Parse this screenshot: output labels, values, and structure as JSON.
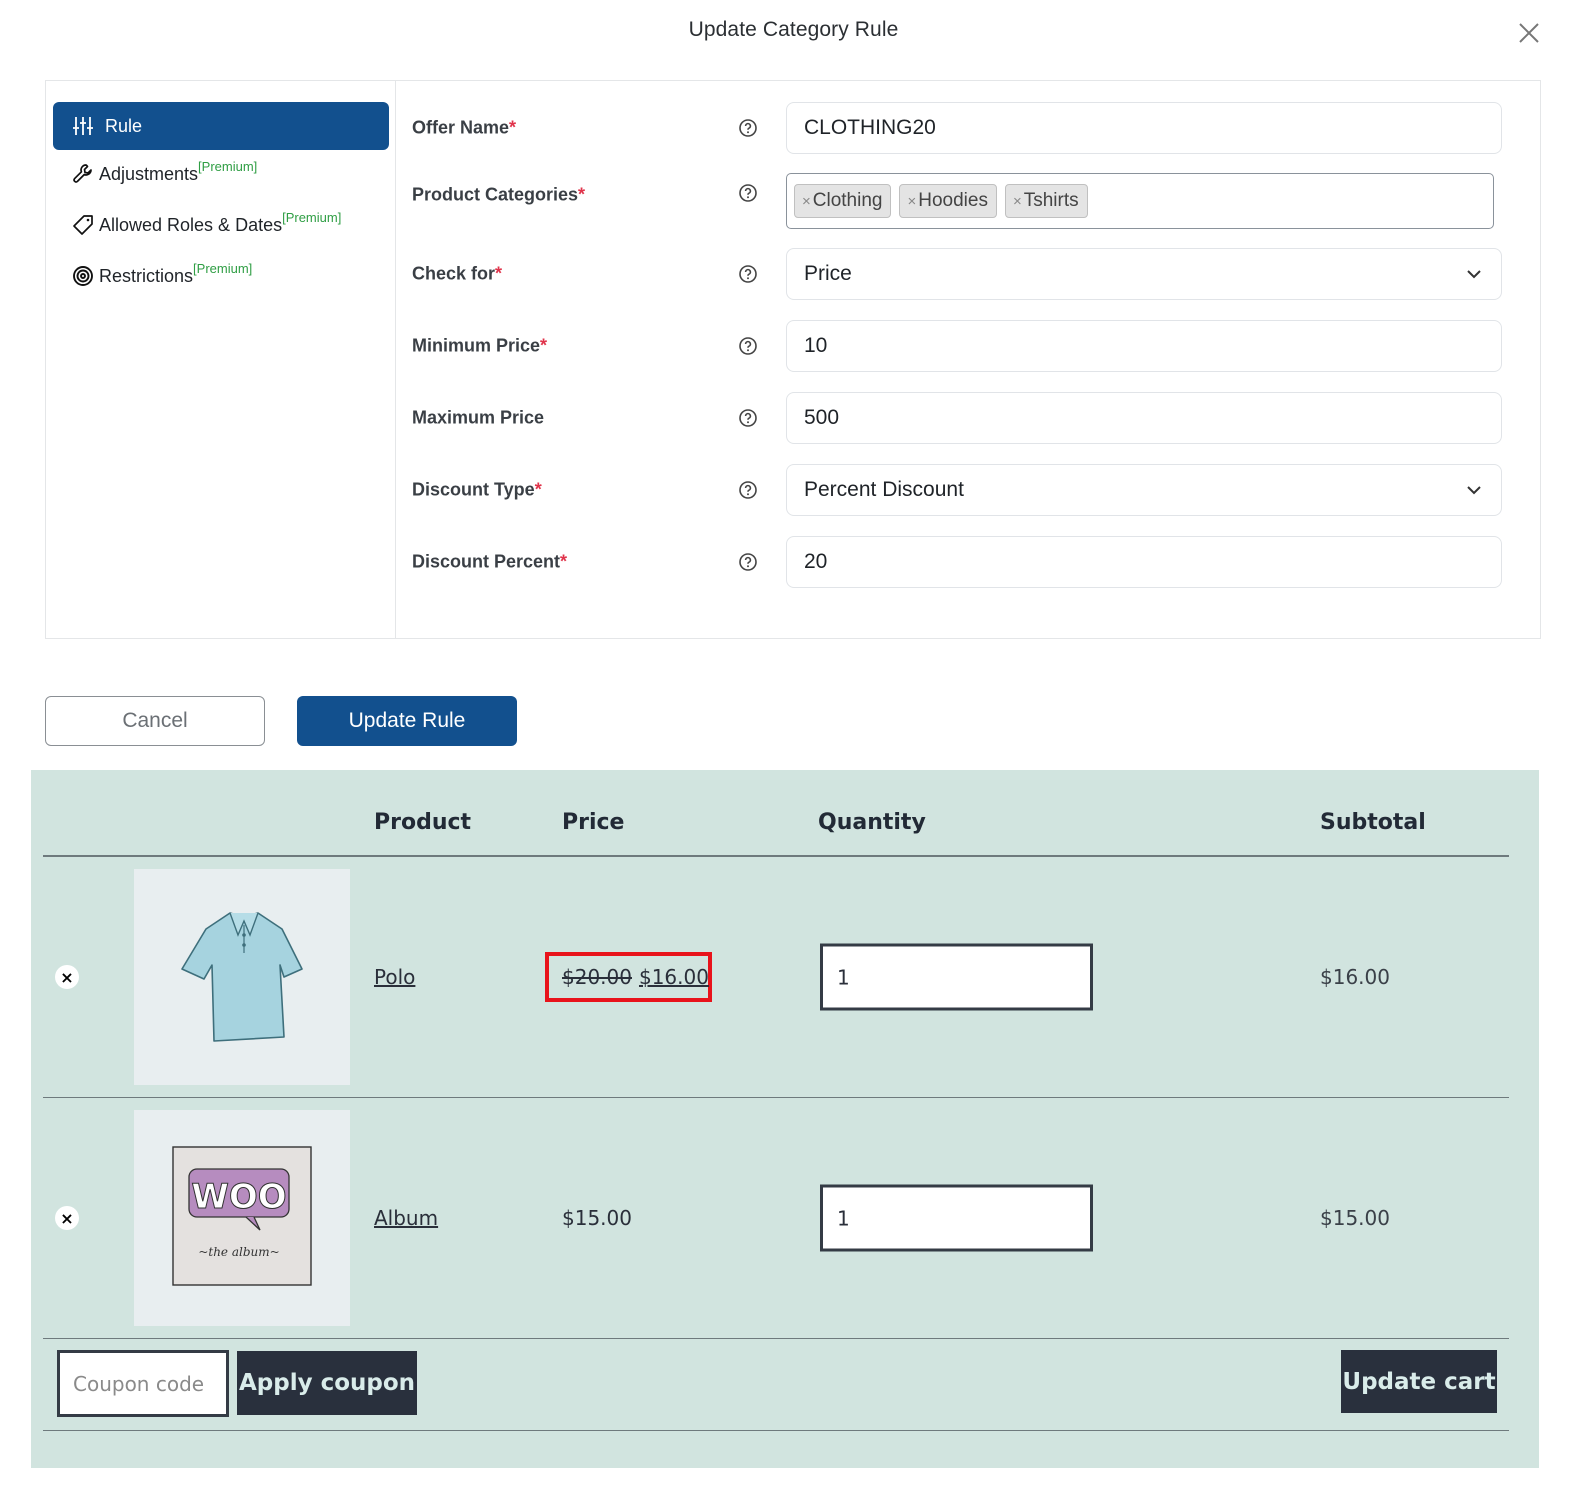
{
  "modal": {
    "title": "Update Category Rule",
    "close_icon": "close-icon"
  },
  "sidebar": {
    "items": [
      {
        "label": "Rule",
        "icon": "sliders-icon",
        "badge": "",
        "active": true
      },
      {
        "label": "Adjustments",
        "icon": "wrench-icon",
        "badge": "[Premium]",
        "active": false
      },
      {
        "label": "Allowed Roles & Dates",
        "icon": "tag-icon",
        "badge": "[Premium]",
        "active": false
      },
      {
        "label": "Restrictions",
        "icon": "target-icon",
        "badge": "[Premium]",
        "active": false
      }
    ]
  },
  "form": {
    "offer_name": {
      "label": "Offer Name",
      "required": "*",
      "value": "CLOTHING20"
    },
    "product_categories": {
      "label": "Product Categories",
      "required": "*",
      "tags": [
        "Clothing",
        "Hoodies",
        "Tshirts"
      ],
      "tag_remove": "×"
    },
    "check_for": {
      "label": "Check for",
      "required": "*",
      "value": "Price"
    },
    "minimum_price": {
      "label": "Minimum Price",
      "required": "*",
      "value": "10"
    },
    "maximum_price": {
      "label": "Maximum Price",
      "required": "",
      "value": "500"
    },
    "discount_type": {
      "label": "Discount Type",
      "required": "*",
      "value": "Percent Discount"
    },
    "discount_percent": {
      "label": "Discount Percent",
      "required": "*",
      "value": "20"
    }
  },
  "buttons": {
    "cancel": "Cancel",
    "update_rule": "Update Rule"
  },
  "cart": {
    "headers": {
      "product": "Product",
      "price": "Price",
      "quantity": "Quantity",
      "subtotal": "Subtotal"
    },
    "remove_glyph": "×",
    "rows": [
      {
        "name": "Polo",
        "image": "polo-shirt-image",
        "old_price": "$20.00",
        "price": "$16.00",
        "quantity": "1",
        "subtotal": "$16.00",
        "highlighted": true
      },
      {
        "name": "Album",
        "image": "woo-album-image",
        "old_price": "",
        "price": "$15.00",
        "quantity": "1",
        "subtotal": "$15.00",
        "highlighted": false
      }
    ],
    "coupon_placeholder": "Coupon code",
    "apply_coupon": "Apply coupon",
    "update_cart": "Update cart",
    "album_art": {
      "word": "WOO",
      "caption": "~the album~"
    }
  },
  "colors": {
    "primary": "#12508e",
    "required": "#e0344b",
    "premium": "#2f9e44",
    "cart_bg": "#d1e4df",
    "cart_button": "#29303d",
    "highlight": "#e8131b"
  }
}
